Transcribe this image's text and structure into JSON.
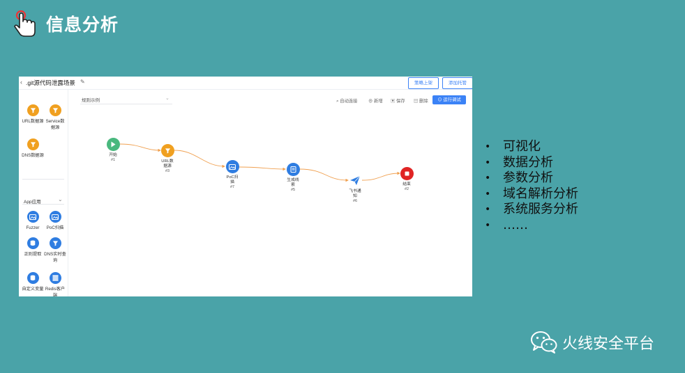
{
  "slide": {
    "title": "信息分析"
  },
  "screenshot": {
    "page_title": ".git源代码泄露场景",
    "top_buttons": {
      "publish": "策略上架",
      "add_hosting": "添加托管"
    },
    "sidebar": {
      "data_sources": [
        {
          "label": "URL数据源",
          "icon": "filter-icon",
          "color": "#f0a020"
        },
        {
          "label": "Service数据源",
          "icon": "filter-icon",
          "color": "#f0a020"
        },
        {
          "label": "DNS数据源",
          "icon": "filter-icon",
          "color": "#f0a020"
        }
      ],
      "section_title": "App应用",
      "apps": [
        {
          "label": "Fuzzer",
          "icon": "image-icon"
        },
        {
          "label": "PoC扫描",
          "icon": "image-icon"
        },
        {
          "label": "正则提取",
          "icon": "database-icon"
        },
        {
          "label": "DNS实时查询",
          "icon": "filter-icon"
        },
        {
          "label": "自定义变量",
          "icon": "database-icon"
        },
        {
          "label": "Redis客户端",
          "icon": "server-icon"
        }
      ]
    },
    "toolbar": {
      "rule_select": "规则示例",
      "auto_connect": "自动连接",
      "add": "新增",
      "save": "保存",
      "delete": "删除",
      "run_debug": "运行调试"
    },
    "flow_nodes": [
      {
        "label": "开始",
        "id": "#1",
        "icon": "play-icon",
        "color": "#49b87e"
      },
      {
        "label": "URL数据源",
        "id": "#3",
        "icon": "filter-icon",
        "color": "#f0a020"
      },
      {
        "label": "PoC扫描",
        "id": "#7",
        "icon": "image-icon",
        "color": "#2f7de1"
      },
      {
        "label": "生成线索",
        "id": "#5",
        "icon": "document-icon",
        "color": "#2f7de1"
      },
      {
        "label": "飞书通知",
        "id": "#6",
        "icon": "send-icon",
        "color": "#2f7de1"
      },
      {
        "label": "结束",
        "id": "#2",
        "icon": "stop-icon",
        "color": "#e02424"
      }
    ],
    "edge_color": "#f0a050"
  },
  "bullets": [
    "可视化",
    "数据分析",
    "参数分析",
    "域名解析分析",
    "系统服务分析",
    "……"
  ],
  "brand": "火线安全平台",
  "colors": {
    "background": "#4aa3a8",
    "accent": "#3b82f6"
  }
}
